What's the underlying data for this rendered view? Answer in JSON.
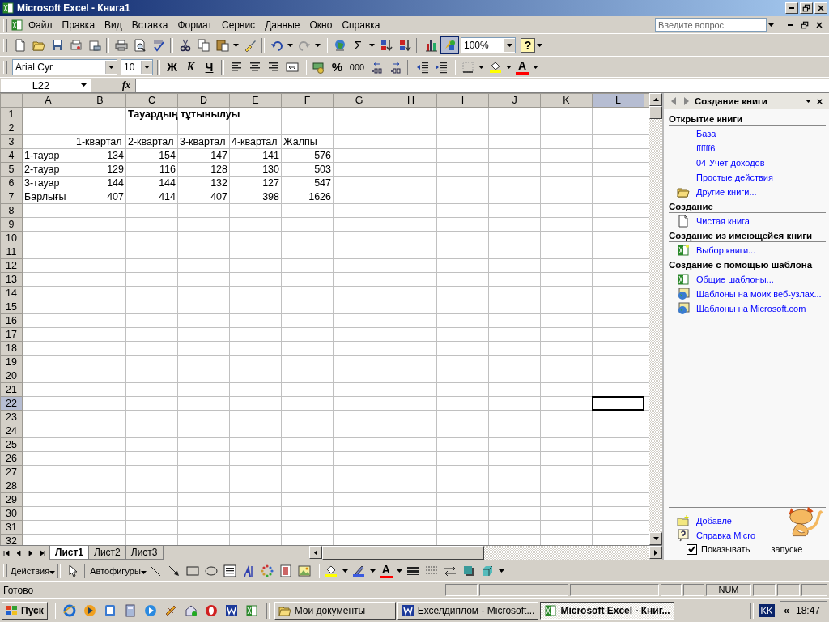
{
  "window": {
    "title": "Microsoft Excel - Книга1"
  },
  "menu": [
    "Файл",
    "Правка",
    "Вид",
    "Вставка",
    "Формат",
    "Сервис",
    "Данные",
    "Окно",
    "Справка"
  ],
  "help_search": {
    "placeholder": "Введите вопрос"
  },
  "standard_toolbar": {
    "sum": "Σ",
    "zoom": "100%",
    "help": "?"
  },
  "formatting_toolbar": {
    "font": "Arial Cyr",
    "size": "10",
    "bold": "Ж",
    "italic": "К",
    "underline": "Ч",
    "percent": "%",
    "thousands": "000",
    "font_color": "A"
  },
  "formula_bar": {
    "name_box": "L22",
    "fx": "fx"
  },
  "sheet": {
    "columns": [
      {
        "label": "A",
        "selected": false
      },
      {
        "label": "B",
        "selected": false
      },
      {
        "label": "C",
        "selected": false
      },
      {
        "label": "D",
        "selected": false
      },
      {
        "label": "E",
        "selected": false
      },
      {
        "label": "F",
        "selected": false
      },
      {
        "label": "G",
        "selected": false
      },
      {
        "label": "H",
        "selected": false
      },
      {
        "label": "I",
        "selected": false
      },
      {
        "label": "J",
        "selected": false
      },
      {
        "label": "K",
        "selected": false
      },
      {
        "label": "L",
        "selected": true
      }
    ],
    "rows": [
      {
        "number": "1",
        "selected": false,
        "kind": "title",
        "cells": [
          "",
          "",
          "Тауардың тұтынылуы"
        ]
      },
      {
        "number": "2",
        "selected": false,
        "kind": "empty",
        "cells": []
      },
      {
        "number": "3",
        "selected": false,
        "kind": "header",
        "cells": [
          "",
          "1-квартал",
          "2-квартал",
          "3-квартал",
          "4-квартал",
          "Жалпы"
        ]
      },
      {
        "number": "4",
        "selected": false,
        "kind": "data",
        "cells": [
          "1-тауар",
          "134",
          "154",
          "147",
          "141",
          "576"
        ]
      },
      {
        "number": "5",
        "selected": false,
        "kind": "data",
        "cells": [
          "2-тауар",
          "129",
          "116",
          "128",
          "130",
          "503"
        ]
      },
      {
        "number": "6",
        "selected": false,
        "kind": "data",
        "cells": [
          "3-тауар",
          "144",
          "144",
          "132",
          "127",
          "547"
        ]
      },
      {
        "number": "7",
        "selected": false,
        "kind": "data",
        "cells": [
          "Барлығы",
          "407",
          "414",
          "407",
          "398",
          "1626"
        ]
      },
      {
        "number": "8",
        "selected": false,
        "kind": "empty",
        "cells": []
      },
      {
        "number": "9",
        "selected": false,
        "kind": "empty",
        "cells": []
      },
      {
        "number": "10",
        "selected": false,
        "kind": "empty",
        "cells": []
      },
      {
        "number": "11",
        "selected": false,
        "kind": "empty",
        "cells": []
      },
      {
        "number": "12",
        "selected": false,
        "kind": "empty",
        "cells": []
      },
      {
        "number": "13",
        "selected": false,
        "kind": "empty",
        "cells": []
      },
      {
        "number": "14",
        "selected": false,
        "kind": "empty",
        "cells": []
      },
      {
        "number": "15",
        "selected": false,
        "kind": "empty",
        "cells": []
      },
      {
        "number": "16",
        "selected": false,
        "kind": "empty",
        "cells": []
      },
      {
        "number": "17",
        "selected": false,
        "kind": "empty",
        "cells": []
      },
      {
        "number": "18",
        "selected": false,
        "kind": "empty",
        "cells": []
      },
      {
        "number": "19",
        "selected": false,
        "kind": "empty",
        "cells": []
      },
      {
        "number": "20",
        "selected": false,
        "kind": "empty",
        "cells": []
      },
      {
        "number": "21",
        "selected": false,
        "kind": "empty",
        "cells": []
      },
      {
        "number": "22",
        "selected": true,
        "kind": "empty",
        "cells": []
      },
      {
        "number": "23",
        "selected": false,
        "kind": "empty",
        "cells": []
      },
      {
        "number": "24",
        "selected": false,
        "kind": "empty",
        "cells": []
      },
      {
        "number": "25",
        "selected": false,
        "kind": "empty",
        "cells": []
      },
      {
        "number": "26",
        "selected": false,
        "kind": "empty",
        "cells": []
      },
      {
        "number": "27",
        "selected": false,
        "kind": "empty",
        "cells": []
      },
      {
        "number": "28",
        "selected": false,
        "kind": "empty",
        "cells": []
      },
      {
        "number": "29",
        "selected": false,
        "kind": "empty",
        "cells": []
      },
      {
        "number": "30",
        "selected": false,
        "kind": "empty",
        "cells": []
      },
      {
        "number": "31",
        "selected": false,
        "kind": "empty",
        "cells": []
      },
      {
        "number": "32",
        "selected": false,
        "kind": "empty",
        "cells": []
      }
    ]
  },
  "sheet_tabs": [
    {
      "label": "Лист1",
      "selected": true
    },
    {
      "label": "Лист2",
      "selected": false
    },
    {
      "label": "Лист3",
      "selected": false
    }
  ],
  "task_pane": {
    "title": "Создание книги",
    "sections": [
      {
        "title": "Открытие книги",
        "items": [
          {
            "text": "База",
            "kind": "recent"
          },
          {
            "text": "ffffff6",
            "kind": "recent"
          },
          {
            "text": "04-Учет доходов",
            "kind": "recent"
          },
          {
            "text": "Простые действия",
            "kind": "recent"
          },
          {
            "text": "Другие книги...",
            "kind": "folder"
          }
        ]
      },
      {
        "title": "Создание",
        "items": [
          {
            "text": "Чистая книга",
            "kind": "blank"
          }
        ]
      },
      {
        "title": "Создание из имеющейся книги",
        "items": [
          {
            "text": "Выбор книги...",
            "kind": "existing"
          }
        ]
      },
      {
        "title": "Создание с помощью шаблона",
        "items": [
          {
            "text": "Общие шаблоны...",
            "kind": "template"
          },
          {
            "text": "Шаблоны на моих веб-узлах...",
            "kind": "web"
          },
          {
            "text": "Шаблоны на Microsoft.com",
            "kind": "web"
          }
        ]
      }
    ],
    "footer": {
      "items": [
        {
          "text": "Добавле",
          "kind": "add"
        },
        {
          "text": "Справка Micro",
          "kind": "help"
        }
      ],
      "checkbox": {
        "label": "Показывать",
        "label_tail": "запуске",
        "checked": true
      }
    }
  },
  "drawing_toolbar": {
    "actions": "Действия",
    "autoshapes": "Автофигуры",
    "font_color": "A"
  },
  "status_bar": {
    "text": "Готово",
    "indicators": [
      "NUM"
    ]
  },
  "taskbar": {
    "start": "Пуск",
    "tasks": [
      {
        "label": "Мои документы",
        "kind": "folder",
        "selected": false
      },
      {
        "label": "Ехселдиплом - Microsoft...",
        "kind": "word",
        "selected": false
      },
      {
        "label": "Microsoft Excel - Книг...",
        "kind": "excel",
        "selected": true
      }
    ],
    "language": "KK",
    "tray_toggle": "«",
    "clock": "18:47"
  }
}
